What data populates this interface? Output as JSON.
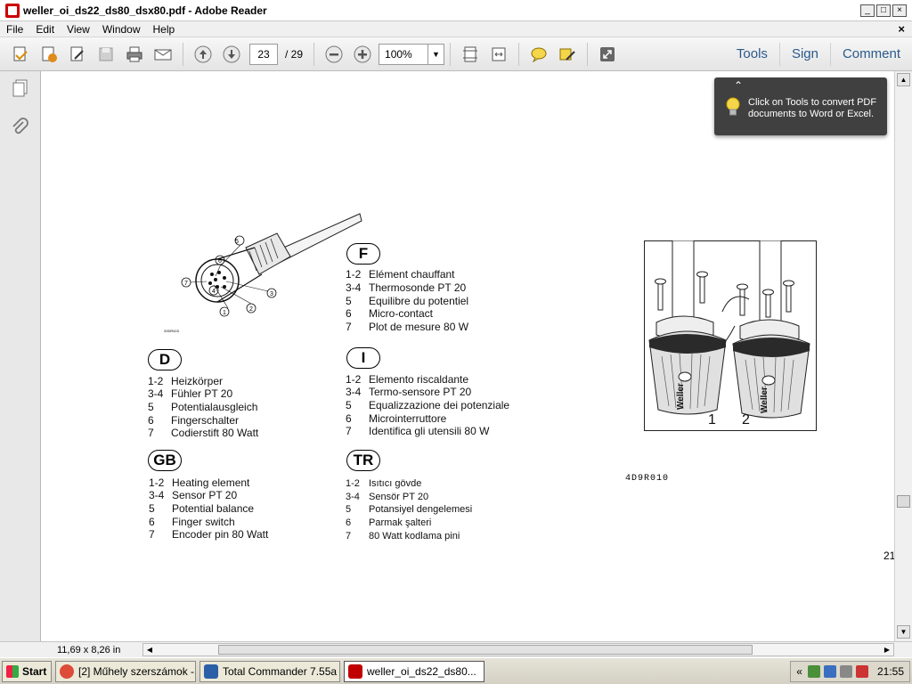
{
  "window": {
    "title": "weller_oi_ds22_ds80_dsx80.pdf - Adobe Reader"
  },
  "menu": [
    "File",
    "Edit",
    "View",
    "Window",
    "Help"
  ],
  "toolbar": {
    "current_page": "23",
    "total_pages": "/ 29",
    "zoom": "100%",
    "links": {
      "tools": "Tools",
      "sign": "Sign",
      "comment": "Comment"
    }
  },
  "tooltip": {
    "text": "Click on Tools to convert PDF documents to Word or Excel."
  },
  "document": {
    "sections": [
      {
        "id": "F",
        "items": [
          {
            "num": "1-2",
            "text": "Elément chauffant"
          },
          {
            "num": "3-4",
            "text": "Thermosonde PT 20"
          },
          {
            "num": "5",
            "text": "Equilibre du potentiel"
          },
          {
            "num": "6",
            "text": "Micro-contact"
          },
          {
            "num": "7",
            "text": "Plot de mesure 80 W"
          }
        ]
      },
      {
        "id": "D",
        "items": [
          {
            "num": "1-2",
            "text": "Heizkörper"
          },
          {
            "num": "3-4",
            "text": "Fühler PT 20"
          },
          {
            "num": "5",
            "text": "Potentialausgleich"
          },
          {
            "num": "6",
            "text": "Fingerschalter"
          },
          {
            "num": "7",
            "text": "Codierstift 80 Watt"
          }
        ]
      },
      {
        "id": "I",
        "items": [
          {
            "num": "1-2",
            "text": "Elemento riscaldante"
          },
          {
            "num": "3-4",
            "text": "Termo-sensore PT 20"
          },
          {
            "num": "5",
            "text": "Equalizzazione dei potenziale"
          },
          {
            "num": "6",
            "text": "Microinterruttore"
          },
          {
            "num": "7",
            "text": "Identifica gli utensili 80 W"
          }
        ]
      },
      {
        "id": "GB",
        "items": [
          {
            "num": "1-2",
            "text": "Heating element"
          },
          {
            "num": "3-4",
            "text": "Sensor PT 20"
          },
          {
            "num": "5",
            "text": "Potential balance"
          },
          {
            "num": "6",
            "text": "Finger switch"
          },
          {
            "num": "7",
            "text": "Encoder pin 80 Watt"
          }
        ]
      },
      {
        "id": "TR",
        "items": [
          {
            "num": "1-2",
            "text": "Isıtıcı gövde"
          },
          {
            "num": "3-4",
            "text": "Sensör PT 20"
          },
          {
            "num": "5",
            "text": "Potansiyel dengelemesi"
          },
          {
            "num": "6",
            "text": "Parmak şalteri"
          },
          {
            "num": "7",
            "text": "80 Watt kodlama pini"
          }
        ]
      }
    ],
    "connector_labels": [
      "1",
      "2",
      "3",
      "4",
      "5",
      "6",
      "7"
    ],
    "connector_code": "20DR415",
    "figure_labels": {
      "left": "1",
      "right": "2",
      "brand": "Weller"
    },
    "figure_code": "4D9R010",
    "page_number": "21"
  },
  "status": {
    "page_size": "11,69 x 8,26 in"
  },
  "taskbar": {
    "start": "Start",
    "tasks": [
      {
        "label": "[2] Műhely szerszámok - ...",
        "color": "#dd4b39"
      },
      {
        "label": "Total Commander 7.55a ...",
        "color": "#2b5fa8"
      },
      {
        "label": "weller_oi_ds22_ds80...",
        "color": "#c00000"
      }
    ],
    "tray_arrows": "«",
    "clock": "21:55"
  }
}
